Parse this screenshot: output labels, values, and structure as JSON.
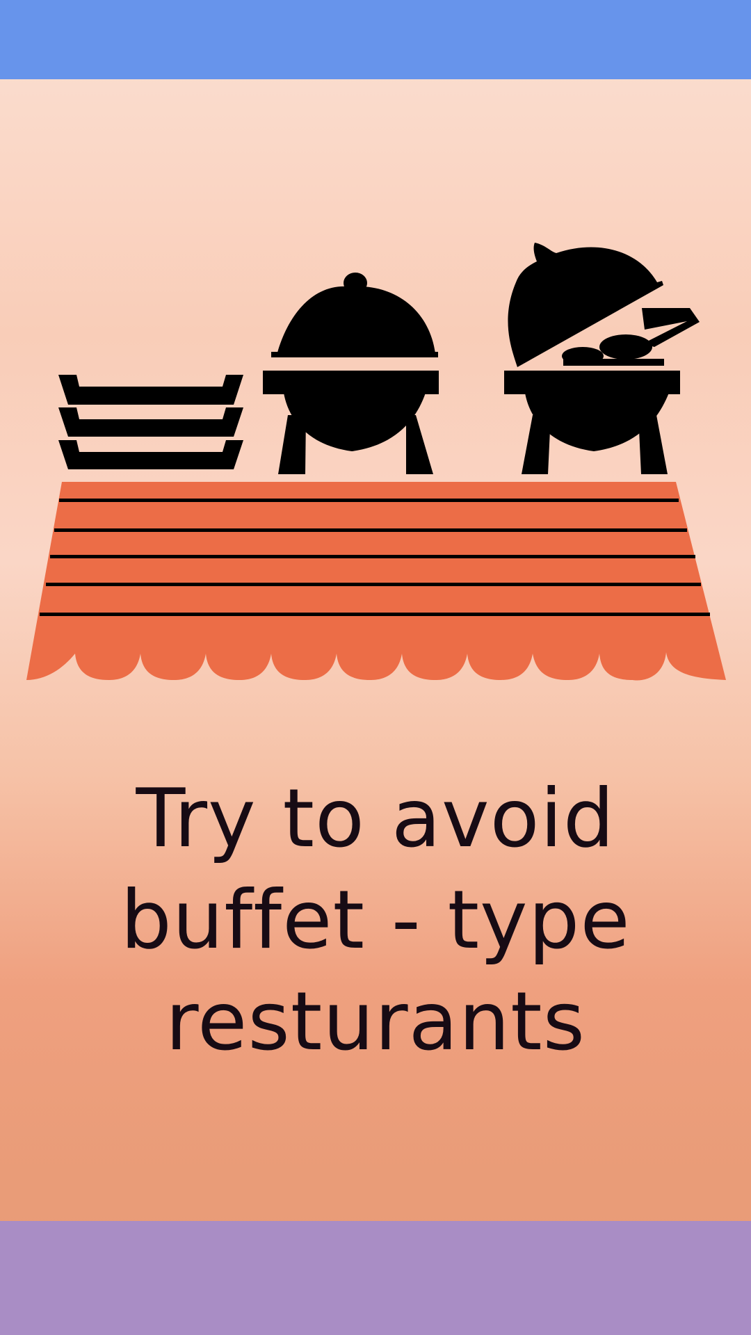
{
  "card": {
    "top_band_color": "#6794eb",
    "bottom_band_color": "#a98dc5",
    "illustration": {
      "subject": "buffet-table-icon",
      "table_color": "#ec6d47",
      "icon_color": "#000000"
    },
    "caption_lines": [
      "Try to avoid",
      "buffet - type",
      "resturants"
    ]
  }
}
